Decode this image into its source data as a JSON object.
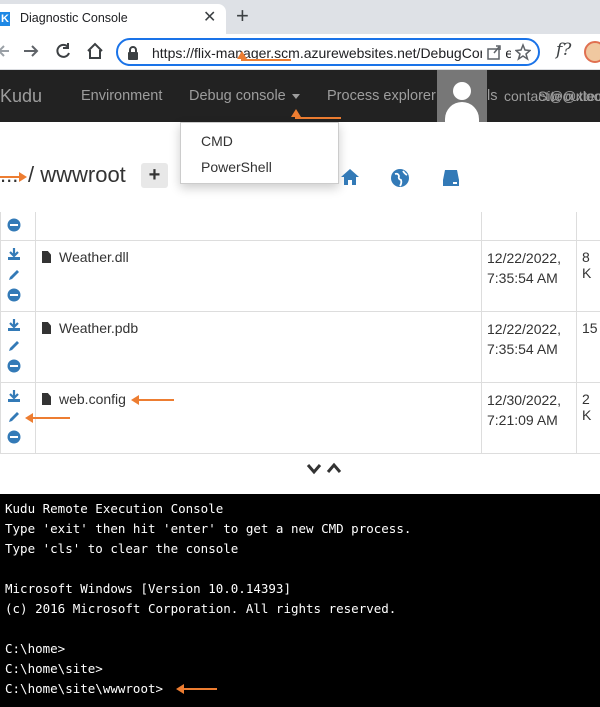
{
  "browser": {
    "tab_title": "Diagnostic Console",
    "favicon_letter": "K",
    "tab_close": "✕",
    "new_tab": "+",
    "url": "https://flix-manager.scm.azurewebsites.net/DebugConsole",
    "extension_label": "f?",
    "icons": [
      "back-icon",
      "forward-icon",
      "reload-icon",
      "home-icon",
      "lock-icon",
      "share-icon",
      "star-icon",
      "extension-icon",
      "profile-icon"
    ]
  },
  "kudu_nav": {
    "brand": "Kudu",
    "items": [
      {
        "label": "Environment"
      },
      {
        "label": "Debug console"
      },
      {
        "label": "Process explorer"
      },
      {
        "label": "ls"
      }
    ],
    "user_email": "contact@outlook",
    "user_site": "Site@xtec"
  },
  "dropdown": {
    "items": [
      "CMD",
      "PowerShell"
    ]
  },
  "path": {
    "ellipsis": "...",
    "separator_name": "/ wwwroot",
    "add_label": "+"
  },
  "files": [
    {
      "name": "",
      "date": "",
      "time": "",
      "size": ""
    },
    {
      "name": "Weather.dll",
      "date": "12/22/2022,",
      "time": "7:35:54 AM",
      "size": "8 K"
    },
    {
      "name": "Weather.pdb",
      "date": "12/22/2022,",
      "time": "7:35:54 AM",
      "size": "15"
    },
    {
      "name": "web.config",
      "date": "12/30/2022,",
      "time": "7:21:09 AM",
      "size": "2 K"
    }
  ],
  "toggle_label": "⌄⌃",
  "console": {
    "lines": [
      "Kudu Remote Execution Console",
      "Type 'exit' then hit 'enter' to get a new CMD process.",
      "Type 'cls' to clear the console",
      "",
      "Microsoft Windows [Version 10.0.14393]",
      "(c) 2016 Microsoft Corporation. All rights reserved.",
      "",
      "C:\\home>",
      "C:\\home\\site>",
      "C:\\home\\site\\wwwroot>"
    ]
  },
  "colors": {
    "nav_bg": "#222222",
    "nav_text": "#9d9d9d",
    "link_blue": "#337ab7",
    "annotation_orange": "#ed7d31",
    "console_bg": "#000000"
  }
}
